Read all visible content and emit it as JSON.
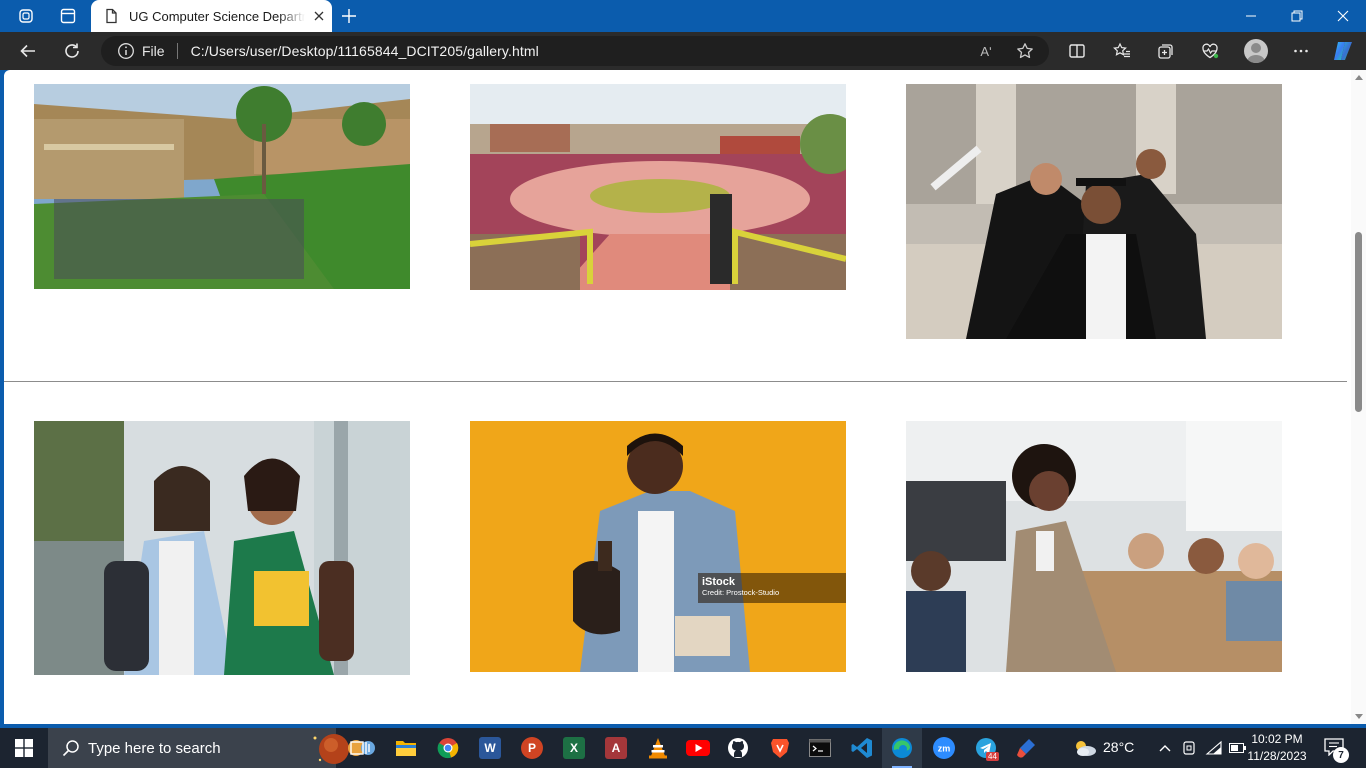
{
  "browser": {
    "tab_title": "UG Computer Science Department",
    "address_scheme_label": "File",
    "url": "C:/Users/user/Desktop/11165844_DCIT205/gallery.html",
    "read_aloud_label": "Aʹ"
  },
  "gallery": {
    "row1": [
      {
        "name": "campus-courtyard-crowd-photo",
        "palette": [
          "#7aa4c9",
          "#a98b5e",
          "#3f8a2c"
        ]
      },
      {
        "name": "campus-walkway-student-photo",
        "palette": [
          "#dfe7ee",
          "#d88b7c",
          "#b6c74a"
        ]
      },
      {
        "name": "graduates-celebrating-photo",
        "palette": [
          "#b5b1aa",
          "#1a1a1a",
          "#d7cfc4"
        ]
      }
    ],
    "row2": [
      {
        "name": "two-students-with-backpacks-photo",
        "palette": [
          "#cfd6d8",
          "#2b7a52",
          "#3c4d66"
        ]
      },
      {
        "name": "smiling-student-yellow-background-photo",
        "palette": [
          "#f0a619",
          "#7c98b6",
          "#2a1d17"
        ]
      },
      {
        "name": "teacher-in-classroom-photo",
        "palette": [
          "#d9dde0",
          "#a79277",
          "#3a3a3a"
        ]
      }
    ],
    "watermark": {
      "brand": "iStock",
      "credit": "Credit: Prostock-Studio"
    }
  },
  "taskbar": {
    "search_placeholder": "Type here to search",
    "weather": "28°C",
    "time": "10:02 PM",
    "date": "11/28/2023",
    "notification_count": "7",
    "apps": [
      "task-view",
      "file-explorer",
      "chrome",
      "word",
      "powerpoint",
      "excel",
      "access",
      "vlc",
      "youtube",
      "github",
      "brave",
      "terminal",
      "vscode",
      "edge",
      "zoom",
      "telegram",
      "paint-tool"
    ],
    "telegram_badge": "44"
  },
  "colors": {
    "titlebar": "#0b5cad",
    "toolbar": "#2b2b2b",
    "taskbar": "#1c2430",
    "page": "#ffffff"
  }
}
